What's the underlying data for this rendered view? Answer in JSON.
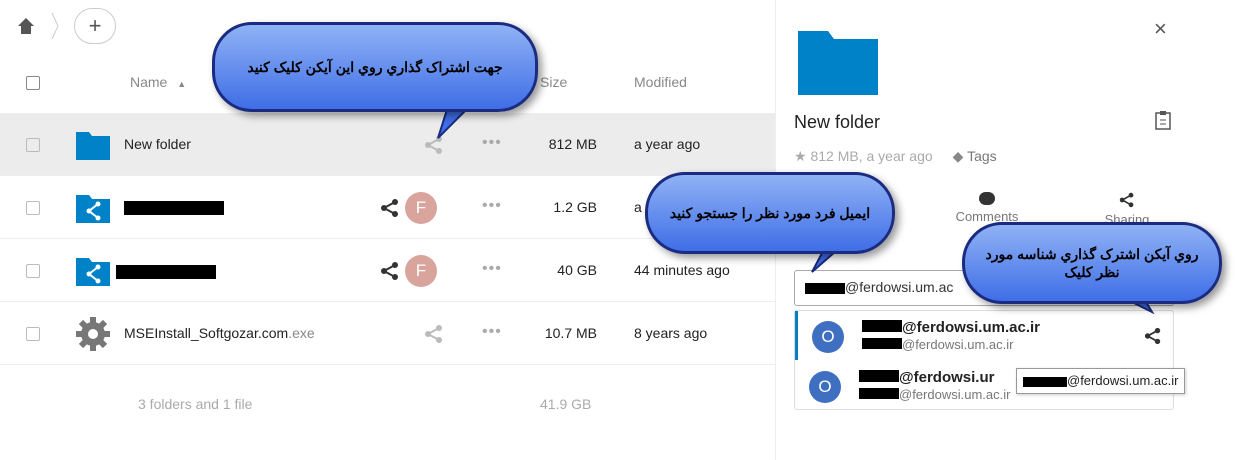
{
  "breadcrumb": {
    "home_icon": "home-icon",
    "add_label": "+"
  },
  "table": {
    "header": {
      "name": "Name",
      "sort": "▲",
      "size": "Size",
      "modified": "Modified"
    },
    "rows": [
      {
        "name": "New folder",
        "ext": "",
        "size": "812 MB",
        "modified": "a year ago",
        "dots": "•••"
      },
      {
        "name": "",
        "ext": "",
        "size": "1.2 GB",
        "modified": "a",
        "dots": "•••",
        "avatar": "F"
      },
      {
        "name": "",
        "ext": "",
        "size": "40 GB",
        "modified": "44 minutes ago",
        "dots": "•••",
        "avatar": "F"
      },
      {
        "name": "MSEInstall_Softgozar.com",
        "ext": ".exe",
        "size": "10.7 MB",
        "modified": "8 years ago",
        "dots": "•••"
      }
    ],
    "summary": {
      "text": "3 folders and 1 file",
      "total": "41.9 GB"
    }
  },
  "sidebar": {
    "close": "×",
    "title": "New folder",
    "meta": "812 MB, a year ago",
    "tags": "Tags",
    "tabs": {
      "comments": "Comments",
      "sharing": "Sharing"
    },
    "input_value": "@ferdowsi.um.ac",
    "results": [
      {
        "avatar": "O",
        "line1": "@ferdowsi.um.ac.ir",
        "line2": "@ferdowsi.um.ac.ir"
      },
      {
        "avatar": "O",
        "line1": "@ferdowsi.ur",
        "line2": "@ferdowsi.um.ac.ir"
      }
    ],
    "tooltip": "@ferdowsi.um.ac.ir"
  },
  "annotations": {
    "bubble1": "جهت اشتراک گذاري روي اين آيکن کليک کنيد",
    "bubble2": "ايميل فرد مورد نظر را جستجو کنيد",
    "bubble3": "روي آيکن اشترک گذاري شناسه مورد نظر کليک"
  },
  "colors": {
    "accent": "#0082c9",
    "folder": "#0082c9",
    "avatar_f": "#d8a49c",
    "avatar_o": "#3e6fc1",
    "bubble": "#5b83ea"
  }
}
